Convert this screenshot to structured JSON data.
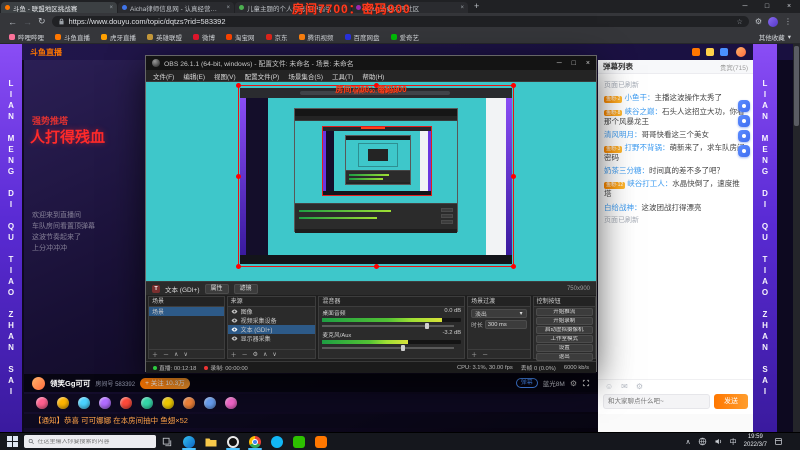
{
  "overlay": {
    "room_text": "房间7700：密码900"
  },
  "browser": {
    "tabs": [
      {
        "title": "斗鱼 - 联盟地区挑战赛"
      },
      {
        "title": "Aicha律师信息网 - 认真经营、以诚信服务"
      },
      {
        "title": "儿童主题的个人信息保护指引"
      },
      {
        "title": "dofun彩虹六号社区"
      }
    ],
    "window_controls": {
      "min": "─",
      "max": "□",
      "close": "×"
    },
    "url": "https://www.douyu.com/topic/dqtzs?rid=583392",
    "bookmarks": [
      {
        "label": "哔哩哔哩",
        "color": "#fb7299"
      },
      {
        "label": "斗鱼直播",
        "color": "#ff7700"
      },
      {
        "label": "虎牙直播",
        "color": "#ffa000"
      },
      {
        "label": "英雄联盟",
        "color": "#c79b3b"
      },
      {
        "label": "微博",
        "color": "#e6162d"
      },
      {
        "label": "淘宝网",
        "color": "#ff4400"
      },
      {
        "label": "京东",
        "color": "#e1251b"
      },
      {
        "label": "腾讯视频",
        "color": "#ff820f"
      },
      {
        "label": "百度网盘",
        "color": "#2932e1"
      },
      {
        "label": "爱奇艺",
        "color": "#00be06"
      }
    ],
    "other_bookmarks": "其他收藏"
  },
  "page": {
    "logo": "斗鱼直播",
    "banner_text": "LIAN MENG DI QU TIAO ZHAN SAI",
    "stream": {
      "tag": "强势推塔",
      "headline": "人打得残血",
      "overlay_lines": [
        "欢迎来到直播间",
        "车队房间看置顶弹幕",
        "这波节奏起来了",
        "上分冲冲冲"
      ]
    },
    "player": {
      "streamer": "领笑Gg可可",
      "room": "房间号 583392",
      "follow": "+ 关注 10.3万",
      "danmu_toggle": "弹幕",
      "quality": "蓝光8M"
    },
    "notice": "【通知】恭喜 可可娜娜 在本房间抽中 鱼翅×52",
    "chat": {
      "title": "弹幕列表",
      "vip": "贵宾(715)",
      "messages": [
        {
          "text": "页面已刷新"
        },
        {
          "badge": "鱼粉·2",
          "user": "小鱼干",
          "text": "主播这波操作太秀了"
        },
        {
          "badge": "鱼粉·8",
          "user": "峡谷之巅",
          "text": "石头人这招立大功，你看那个风暴龙王"
        },
        {
          "user": "清风明月",
          "text": "哥哥快看这三个美女"
        },
        {
          "badge": "鱼粉·3",
          "user": "打野不背锅",
          "text": "萌新来了，求车队房间密码"
        },
        {
          "user": "奶茶三分糖",
          "text": "时间真的差不多了吧？"
        },
        {
          "badge": "鱼粉·12",
          "user": "峡谷打工人",
          "text": "水晶快倒了，速度推塔"
        },
        {
          "user": "白给战神",
          "text": "这波团战打得漂亮"
        },
        {
          "text": "页面已刷新"
        }
      ],
      "input_placeholder": "和大家聊点什么吧~",
      "send": "发送"
    }
  },
  "obs": {
    "title": "OBS 26.1.1 (64-bit, windows) - 配置文件: 未命名 - 场景: 未命名",
    "menus": [
      "文件(F)",
      "编辑(E)",
      "视图(V)",
      "配置文件(P)",
      "场景集合(S)",
      "工具(T)",
      "帮助(H)"
    ],
    "source_toolbar": {
      "source": "文本 (GDI+)",
      "properties": "属性",
      "filters": "滤镜",
      "size": "750x900"
    },
    "scenes": {
      "title": "场景",
      "items": [
        "场景"
      ]
    },
    "sources": {
      "title": "来源",
      "items": [
        "图像",
        "视频采集设备",
        "文本 (GDI+)",
        "显示器采集"
      ]
    },
    "mixer": {
      "title": "混音器",
      "channels": [
        {
          "name": "桌面音频",
          "db": "0.0 dB",
          "level": "86%"
        },
        {
          "name": "麦克风/Aux",
          "db": "-3.2 dB",
          "level": "62%"
        }
      ]
    },
    "transitions": {
      "title": "场景过渡",
      "value": "淡出",
      "duration_label": "时长",
      "duration": "300 ms"
    },
    "controls": {
      "title": "控制按钮",
      "buttons": [
        "开始推流",
        "开始录制",
        "启动虚拟摄像机",
        "工作室模式",
        "设置",
        "退出"
      ]
    },
    "statusbar": {
      "live": "直播: 00:12:18",
      "rec": "录制: 00:00:00",
      "cpu": "CPU: 3.1%, 30.00 fps",
      "dropped": "丢帧 0 (0.0%)",
      "bitrate": "6000 kb/s"
    }
  },
  "taskbar": {
    "search_placeholder": "在这里输入你要搜索的内容",
    "ime": "中",
    "time": "19:59",
    "date": "2022/3/7"
  }
}
